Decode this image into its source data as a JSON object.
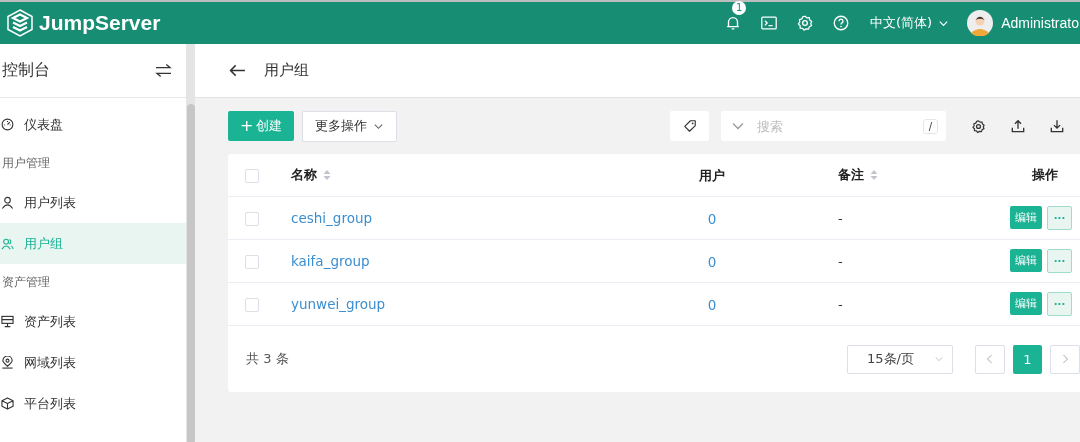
{
  "header": {
    "brand": "JumpServer",
    "notification_count": "1",
    "language": "中文(简体)",
    "user": "Administrato"
  },
  "sidebar": {
    "title": "控制台",
    "items": [
      {
        "kind": "item",
        "label": "仪表盘",
        "selected": false
      },
      {
        "kind": "heading",
        "label": "用户管理"
      },
      {
        "kind": "item",
        "label": "用户列表",
        "selected": false
      },
      {
        "kind": "item",
        "label": "用户组",
        "selected": true
      },
      {
        "kind": "heading",
        "label": "资产管理"
      },
      {
        "kind": "item",
        "label": "资产列表",
        "selected": false
      },
      {
        "kind": "item",
        "label": "网域列表",
        "selected": false
      },
      {
        "kind": "item",
        "label": "平台列表",
        "selected": false
      }
    ]
  },
  "page": {
    "title": "用户组"
  },
  "toolbar": {
    "create_icon": "+",
    "create": "创建",
    "more": "更多操作",
    "search": {
      "placeholder": "搜索",
      "shortcut": "/"
    }
  },
  "table": {
    "select_all": false,
    "columns": [
      {
        "label": "名称",
        "sortable": true
      },
      {
        "label": "用户",
        "sortable": false
      },
      {
        "label": "备注",
        "sortable": true
      },
      {
        "label": "操作",
        "sortable": false
      }
    ],
    "rows": [
      {
        "selected": false,
        "name": "ceshi_group",
        "users": "0",
        "comment": "-",
        "edit": "编辑",
        "more": "···"
      },
      {
        "selected": false,
        "name": "kaifa_group",
        "users": "0",
        "comment": "-",
        "edit": "编辑",
        "more": "···"
      },
      {
        "selected": false,
        "name": "yunwei_group",
        "users": "0",
        "comment": "-",
        "edit": "编辑",
        "more": "···"
      }
    ]
  },
  "pagination": {
    "total": "共 3 条",
    "page_size": "15条/页",
    "pages": [
      {
        "label": "1",
        "selected": true
      }
    ]
  }
}
